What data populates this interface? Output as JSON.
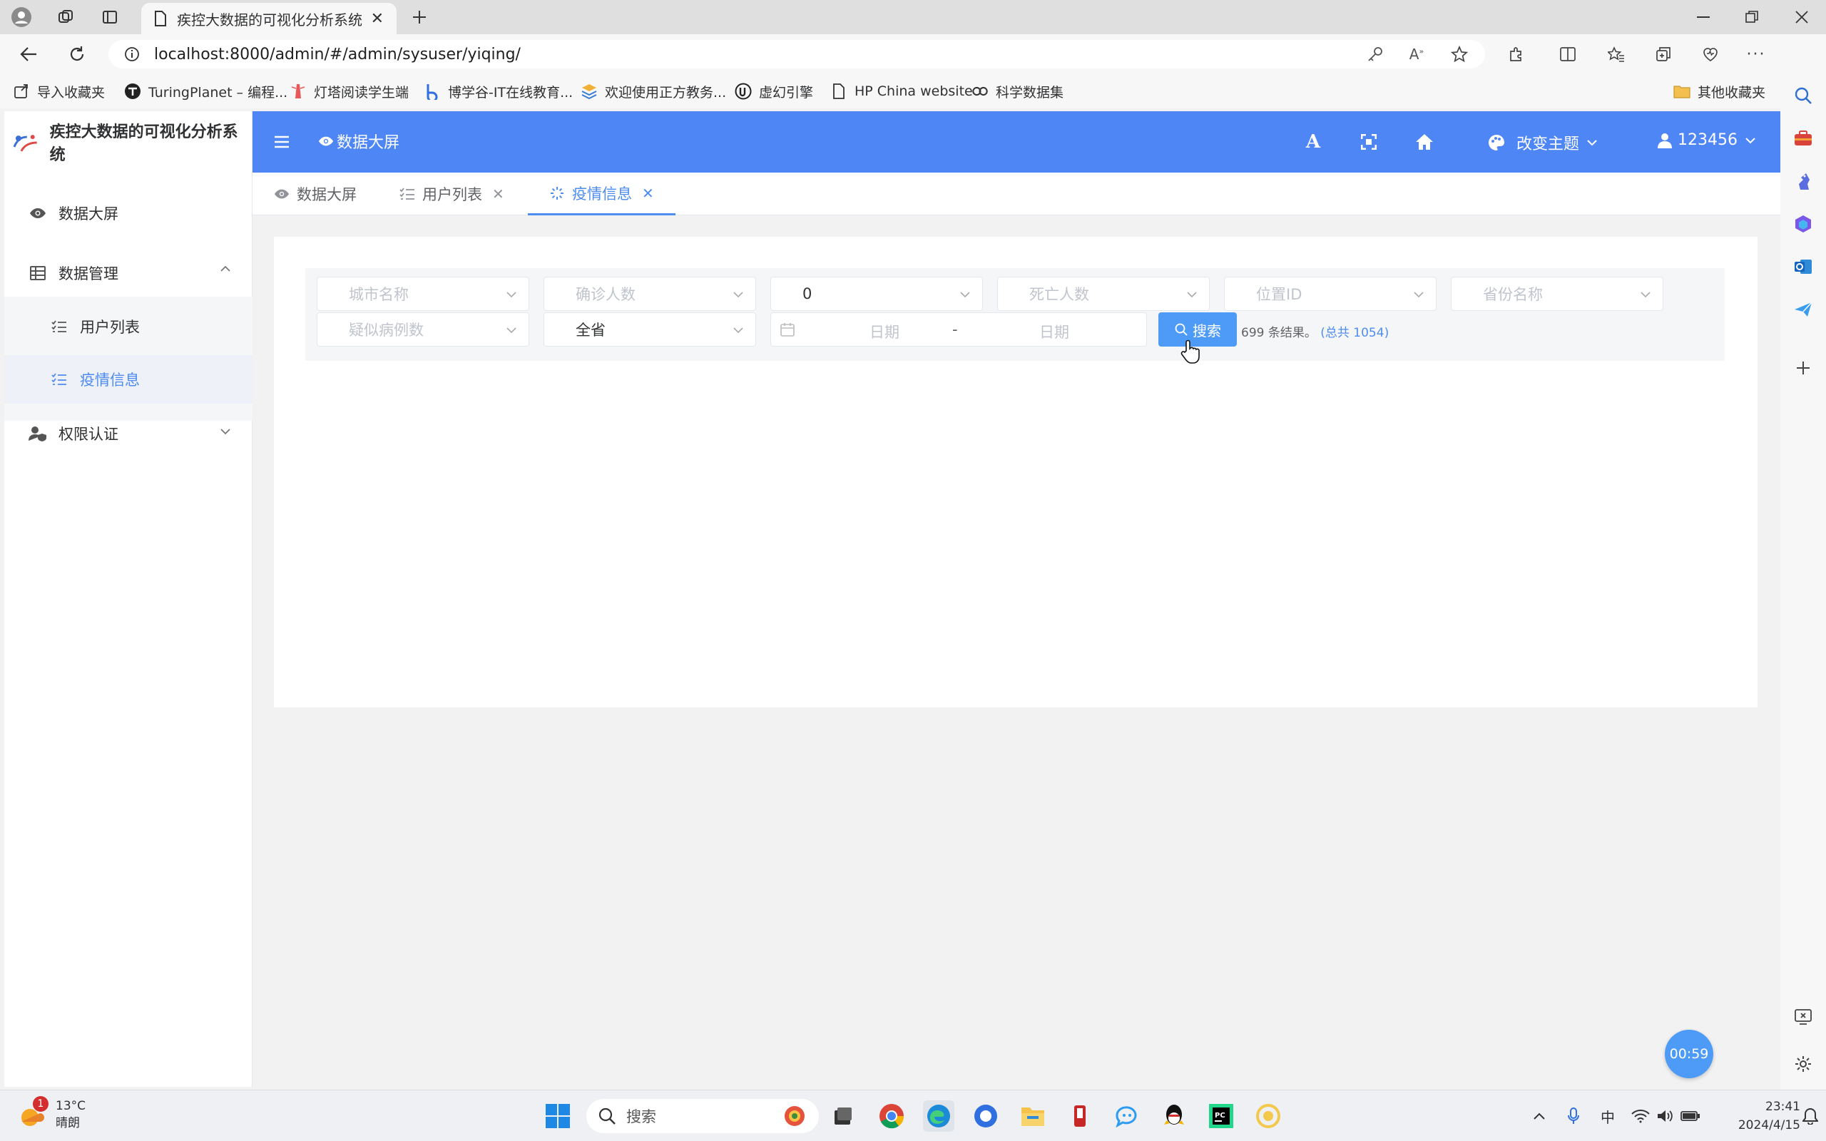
{
  "browser": {
    "tab_title": "疾控大数据的可视化分析系统",
    "url": "localhost:8000/admin/#/admin/sysuser/yiqing/",
    "bookmarks": [
      {
        "label": "导入收藏夹",
        "icon": "import-icon"
      },
      {
        "label": "TuringPlanet – 编程...",
        "icon": "turing-icon"
      },
      {
        "label": "灯塔阅读学生端",
        "icon": "lighthouse-icon"
      },
      {
        "label": "博学谷-IT在线教育...",
        "icon": "boxuegu-icon"
      },
      {
        "label": "欢迎使用正方教务...",
        "icon": "zhengfang-icon"
      },
      {
        "label": "虚幻引擎",
        "icon": "unreal-icon"
      },
      {
        "label": "HP China website",
        "icon": "page-icon"
      },
      {
        "label": "科学数据集",
        "icon": "link-icon"
      }
    ],
    "other_bookmarks": "其他收藏夹"
  },
  "app": {
    "brand": "疾控大数据的可视化分析系统",
    "menu": {
      "dashboard": "数据大屏",
      "data_manage": "数据管理",
      "user_list": "用户列表",
      "epidemic_info": "疫情信息",
      "auth": "权限认证"
    },
    "topbar": {
      "title": "数据大屏",
      "theme": "改变主题",
      "user": "123456"
    },
    "tabs": [
      {
        "label": "数据大屏"
      },
      {
        "label": "用户列表"
      },
      {
        "label": "疫情信息"
      }
    ],
    "filters": {
      "city": "城市名称",
      "confirmed": "确诊人数",
      "third_value": "0",
      "deaths": "死亡人数",
      "location_id": "位置ID",
      "province": "省份名称",
      "suspected": "疑似病例数",
      "scope": "全省",
      "date_start": "日期",
      "date_sep": "-",
      "date_end": "日期",
      "search": "搜索"
    },
    "results": {
      "count_text": "699 条结果。",
      "total_text": "(总共 1054)"
    },
    "timer": "00:59"
  },
  "taskbar": {
    "temp": "13°C",
    "weather": "晴朗",
    "weather_badge": "1",
    "search": "搜索",
    "ime": "中",
    "time": "23:41",
    "date": "2024/4/15"
  },
  "colors": {
    "primary": "#4e86f5",
    "accent": "#4e8cf0",
    "button": "#4e9bf7"
  }
}
